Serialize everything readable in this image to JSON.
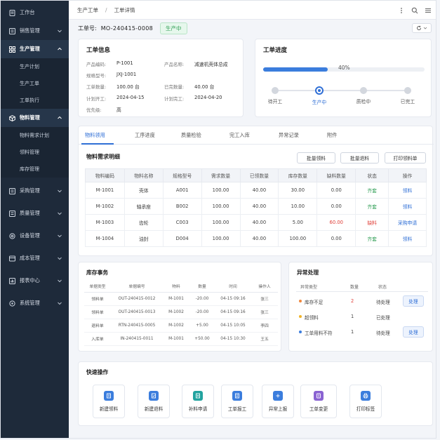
{
  "sidebar": {
    "items": [
      {
        "label": "工作台",
        "icon": "doc-icon",
        "chevron": false
      },
      {
        "label": "销售管理",
        "icon": "list-icon",
        "chevron": true
      },
      {
        "label": "生产管理",
        "icon": "grid-icon",
        "chevron": true,
        "open": true,
        "children": [
          "生产计划",
          "生产工单",
          "工单执行"
        ]
      },
      {
        "label": "物料管理",
        "icon": "box-icon",
        "chevron": true,
        "open": true,
        "children": [
          "物料需求计划",
          "领料管理",
          "库存管理"
        ]
      },
      {
        "label": "采购管理",
        "icon": "cart-icon",
        "chevron": true
      },
      {
        "label": "质量管理",
        "icon": "shield-icon",
        "chevron": true
      },
      {
        "label": "设备管理",
        "icon": "gear-icon",
        "chevron": true
      },
      {
        "label": "成本管理",
        "icon": "coin-icon",
        "chevron": true
      },
      {
        "label": "报表中心",
        "icon": "chart-icon",
        "chevron": true
      },
      {
        "label": "系统管理",
        "icon": "settings-icon",
        "chevron": true
      }
    ]
  },
  "breadcrumb": {
    "parent": "生产工单",
    "separator": "/",
    "current": "工单详情"
  },
  "header": {
    "wo_label": "工单号:",
    "wo_number": "MO-240415-0008",
    "status": "生产中"
  },
  "info": {
    "title": "工单信息",
    "fields": [
      {
        "label": "产品编码:",
        "value": "P-1001"
      },
      {
        "label": "产品名称:",
        "value": "减速机壳体总成"
      },
      {
        "label": "规格型号:",
        "value": "JXJ-1001"
      },
      {
        "label": "工单数量:",
        "value": "100.00  台"
      },
      {
        "label": "已完数量:",
        "value": "40.00  台"
      },
      {
        "label": "计划开工:",
        "value": "2024-04-15"
      },
      {
        "label": "计划完工:",
        "value": "2024-04-20"
      },
      {
        "label": "优先级:",
        "value": "高"
      }
    ]
  },
  "progress": {
    "title": "工单进度",
    "percent": 40,
    "percent_label": "40%",
    "steps": [
      "待开工",
      "生产中",
      "质检中",
      "已完工"
    ],
    "active_step": 1
  },
  "tabs": [
    "物料领用",
    "工序进度",
    "质量检验",
    "完工入库",
    "异常记录",
    "附件"
  ],
  "materials": {
    "title": "物料需求明细",
    "buttons": [
      "批量领料",
      "批量退料",
      "打印领料单"
    ],
    "columns": [
      "物料编码",
      "物料名称",
      "规格型号",
      "需求数量",
      "已领数量",
      "库存数量",
      "缺料数量",
      "状态",
      "操作"
    ],
    "rows": [
      {
        "code": "M-1001",
        "name": "壳体",
        "spec": "A001",
        "need": "100.00",
        "got": "40.00",
        "stock": "30.00",
        "short": "0.00",
        "status": "齐套",
        "action": "领料"
      },
      {
        "code": "M-1002",
        "name": "轴承座",
        "spec": "B002",
        "need": "100.00",
        "got": "40.00",
        "stock": "10.00",
        "short": "0.00",
        "status": "齐套",
        "action": "领料"
      },
      {
        "code": "M-1003",
        "name": "齿轮",
        "spec": "C003",
        "need": "100.00",
        "got": "40.00",
        "stock": "5.00",
        "short": "60.00",
        "status": "缺料",
        "action": "采购申请"
      },
      {
        "code": "M-1004",
        "name": "油封",
        "spec": "D004",
        "need": "100.00",
        "got": "40.00",
        "stock": "100.00",
        "short": "0.00",
        "status": "齐套",
        "action": "领料"
      }
    ]
  },
  "stock_tx": {
    "title": "库存事务",
    "columns": [
      "单据类型",
      "单据编号",
      "物料",
      "数量",
      "时间",
      "操作人"
    ],
    "rows": [
      [
        "领料单",
        "OUT-240415-0012",
        "M-1001",
        "-20.00",
        "04-15 09:16",
        "张三"
      ],
      [
        "领料单",
        "OUT-240415-0013",
        "M-1002",
        "-20.00",
        "04-15 09:16",
        "张三"
      ],
      [
        "退料单",
        "RTN-240415-0005",
        "M-1002",
        "+5.00",
        "04-15 10:05",
        "李四"
      ],
      [
        "入库单",
        "IN-240415-0011",
        "M-1001",
        "+50.00",
        "04-15 10:30",
        "王五"
      ]
    ]
  },
  "exceptions": {
    "title": "异常处理",
    "columns": [
      "异常类型",
      "数量",
      "状态"
    ],
    "rows": [
      {
        "type": "库存不足",
        "count": "2",
        "status": "待处理",
        "action": "处理",
        "color": "#f0883e",
        "count_red": true
      },
      {
        "type": "超领料",
        "count": "1",
        "status": "已处理",
        "action": "",
        "color": "#f0b429",
        "count_red": false
      },
      {
        "type": "工单用料不符",
        "count": "1",
        "status": "待处理",
        "action": "处理",
        "color": "#3b7ddd",
        "count_red": false
      }
    ]
  },
  "quick": {
    "title": "快速操作",
    "items": [
      {
        "label": "新建领料",
        "icon": "new-pick-icon",
        "color": "#3b7ddd"
      },
      {
        "label": "新建退料",
        "icon": "new-return-icon",
        "color": "#3b7ddd"
      },
      {
        "label": "补料申请",
        "icon": "supplement-icon",
        "color": "#22a39f"
      },
      {
        "label": "工单报工",
        "icon": "report-icon",
        "color": "#3b7ddd"
      },
      {
        "label": "异常上报",
        "icon": "exception-icon",
        "color": "#3b7ddd"
      },
      {
        "label": "工单变更",
        "icon": "change-icon",
        "color": "#8a63d2"
      },
      {
        "label": "打印标签",
        "icon": "print-icon",
        "color": "#3b7ddd"
      }
    ]
  }
}
